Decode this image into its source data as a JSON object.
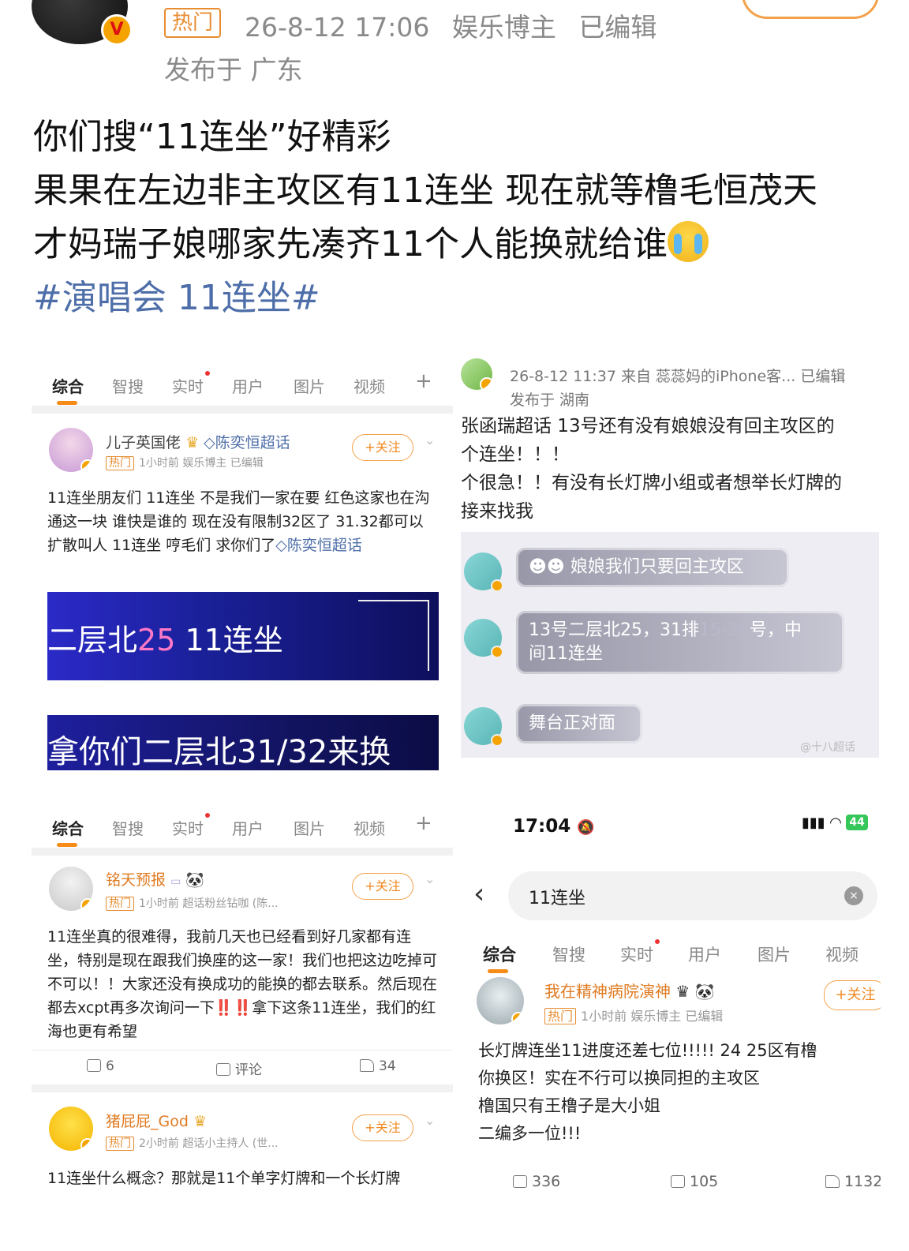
{
  "post": {
    "hot_tag": "热门",
    "time": "26-8-12 17:06",
    "role": "娱乐博主",
    "edited": "已编辑",
    "location": "发布于 广东",
    "line1": "你们搜“11连坐”好精彩",
    "line2": "果果在左边非主攻区有11连坐 现在就等橹毛恒茂天",
    "line3": "才妈瑞子娘哪家先凑齐11个人能换就给谁",
    "hashtag": "#演唱会 11连坐#",
    "emoji": "cry-emoji",
    "verify_badge": "V"
  },
  "tabs": {
    "labels": [
      "综合",
      "智搜",
      "实时",
      "用户",
      "图片",
      "视频",
      "+"
    ]
  },
  "panel1": {
    "user": "儿子英国佬",
    "supertopic": "陈奕恒超话",
    "hot": "热门",
    "meta": "1小时前  娱乐博主  已编辑",
    "follow": "+关注",
    "body": "11连坐朋友们 11连坐 不是我们一家在要 红色这家也在沟通这一块 谁快是谁的 现在没有限制32区了 31.32都可以 扩散叫人 11连坐 哼毛们 求你们了",
    "body_link": "陈奕恒超话",
    "banner1_prefix": "二层北",
    "banner1_hl": "25",
    "banner1_suffix": " 11连坐",
    "banner2": "拿你们二层北31/32来换"
  },
  "panel2": {
    "meta": "26-8-12 11:37  来自 蕊蕊妈的iPhone客...  已编辑",
    "location": "发布于 湖南",
    "line1": "张函瑞超话 13号还有没有娘娘没有回主攻区的",
    "line2": "个连坐！！！",
    "line3": "个很急！！有没有长灯牌小组或者想举长灯牌的",
    "line4": "接来找我",
    "bubble1": "娘娘我们只要回主攻区",
    "bubble2_a": "13号二层北25，31排",
    "bubble2_b": "15-36",
    "bubble2_c": "号，中",
    "bubble2_d": "间11连坐",
    "bubble3": "舞台正对面",
    "watermark": "@十八超话"
  },
  "panel3": {
    "user": "铭天预报",
    "hot": "热门",
    "meta": "1小时前  超话粉丝钻咖 (陈...",
    "follow": "+关注",
    "body_a": "11连坐真的很难得，我前几天也已经看到好几家都有连坐，特别是现在跟我们换座的这一家！我们也把这边吃掉可不可以！！大家还没有换成功的能换的都去联系。然后现在都去xcpt再多次询问一下",
    "bang": "‼️‼️",
    "body_b": "拿下这条11连坐，我们的红海也更有希望",
    "reposts": "6",
    "comments": "评论",
    "likes": "34",
    "user2": "猪屁屁_God",
    "hot2": "热门",
    "meta2": "2小时前  超话小主持人 (世...",
    "follow2": "+关注",
    "body2": "11连坐什么概念？那就是11个单字灯牌和一个长灯牌"
  },
  "panel4": {
    "time": "17:04",
    "battery": "44",
    "query": "11连坐",
    "clear": "×",
    "back": "‹",
    "tabs": [
      "综合",
      "智搜",
      "实时",
      "用户",
      "图片",
      "视频"
    ],
    "user": "我在精神病院演神",
    "hot": "热门",
    "meta": "1小时前  娱乐博主  已编辑",
    "follow": "+关注",
    "line1": "长灯牌连坐11进度还差七位!!!!!  24 25区有橹",
    "line2": "你换区！实在不行可以换同担的主攻区",
    "line3": "橹国只有王橹子是大小姐",
    "line4": "二编多一位!!!",
    "reposts": "336",
    "comments": "105",
    "likes": "1132"
  },
  "colors": {
    "accent": "#f08a24",
    "link": "#4d6ea8",
    "meta": "#8a8a8a"
  }
}
